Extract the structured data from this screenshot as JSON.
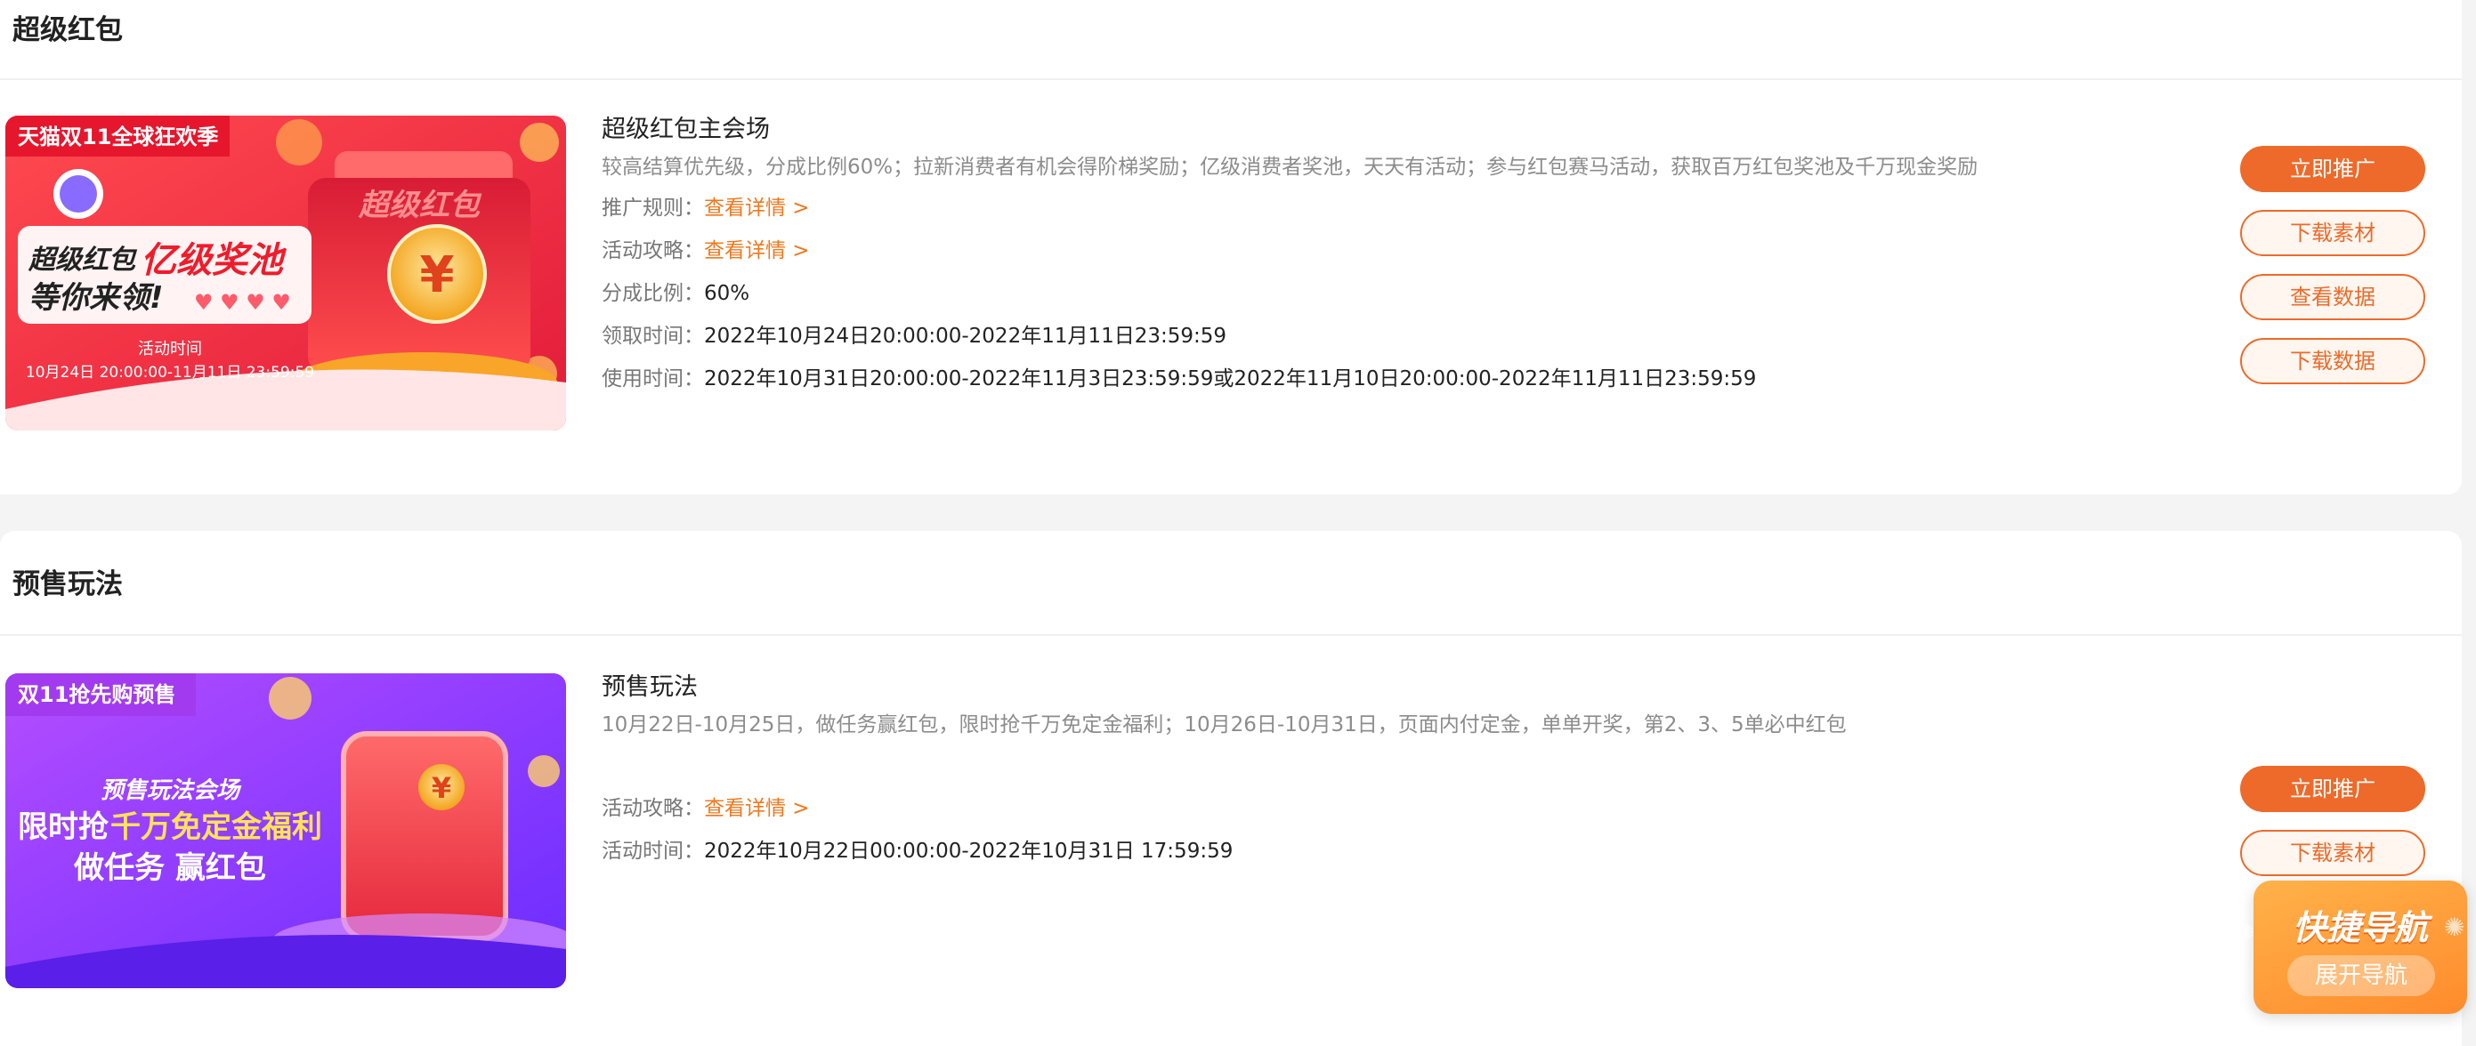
{
  "sections": [
    {
      "title": "超级红包",
      "banner": {
        "corner_tag": "天猫双11全球狂欢季",
        "headline_a": "超级红包",
        "headline_b": "亿级奖池",
        "headline_c": "等你来领!",
        "time_label": "活动时间",
        "time_range": "10月24日 20:00:00-11月11日 23:59:59",
        "packet_text": "超级红包",
        "coin_symbol": "¥"
      },
      "card": {
        "title": "超级红包主会场",
        "desc": "较高结算优先级，分成比例60%；拉新消费者有机会得阶梯奖励；亿级消费者奖池，天天有活动；参与红包赛马活动，获取百万红包奖池及千万现金奖励",
        "rows": [
          {
            "key": "推广规则：",
            "link": "查看详情 >"
          },
          {
            "key": "活动攻略：",
            "link": "查看详情 >"
          },
          {
            "key": "分成比例：",
            "value": "60%"
          },
          {
            "key": "领取时间：",
            "value": "2022年10月24日20:00:00-2022年11月11日23:59:59"
          },
          {
            "key": "使用时间：",
            "value": "2022年10月31日20:00:00-2022年11月3日23:59:59或2022年11月10日20:00:00-2022年11月11日23:59:59"
          }
        ]
      },
      "buttons": [
        "立即推广",
        "下载素材",
        "查看数据",
        "下载数据"
      ]
    },
    {
      "title": "预售玩法",
      "banner": {
        "corner_tag": "双11抢先购预售",
        "sub": "预售玩法会场",
        "line1_a": "限时抢",
        "line1_b": "千万免定金福利",
        "line2": "做任务 赢红包",
        "coin_symbol": "¥"
      },
      "card": {
        "title": "预售玩法",
        "desc": "10月22日-10月25日，做任务赢红包，限时抢千万免定金福利；10月26日-10月31日，页面内付定金，单单开奖，第2、3、5单必中红包",
        "rows": [
          {
            "key": "活动攻略：",
            "link": "查看详情 >"
          },
          {
            "key": "活动时间：",
            "value": "2022年10月22日00:00:00-2022年10月31日 17:59:59"
          }
        ]
      },
      "buttons": [
        "立即推广",
        "下载素材"
      ]
    }
  ],
  "quick_nav": {
    "title": "快捷导航",
    "button": "展开导航"
  },
  "colors": {
    "accent": "#ee6a2a",
    "link": "#f0781e"
  }
}
